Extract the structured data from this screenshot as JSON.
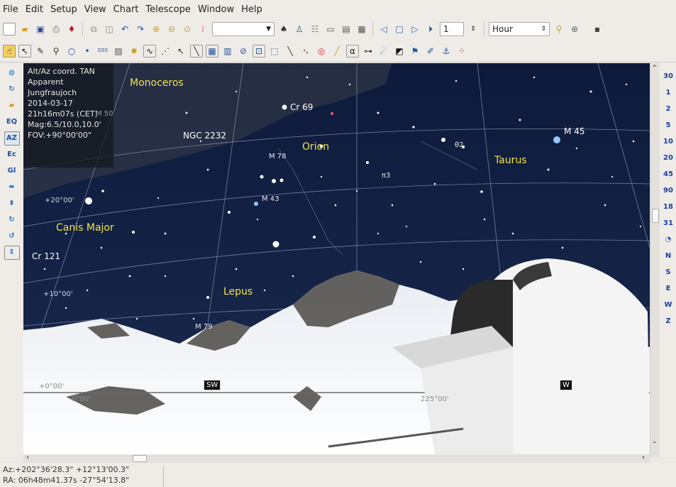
{
  "menu": [
    "File",
    "Edit",
    "Setup",
    "View",
    "Chart",
    "Telescope",
    "Window",
    "Help"
  ],
  "toolbar": {
    "search_value": "",
    "step_value": "1",
    "time_unit": "Hour"
  },
  "info": {
    "lines": [
      "Alt/Az coord. TAN",
      "Apparent",
      "Jungfraujoch",
      "2014-03-17",
      "21h16m07s (CET)",
      "Mag:6.5/10.0,10.0'",
      "FOV:+90°00'00\""
    ]
  },
  "sky": {
    "constellations": {
      "monoceros": "Monoceros",
      "orion": "Orion",
      "taurus": "Taurus",
      "canis_major": "Canis Major",
      "lepus": "Lepus"
    },
    "objects": {
      "cr69": "Cr 69",
      "ngc2232": "NGC 2232",
      "m45": "M 45",
      "m78": "M 78",
      "m43": "M 43",
      "cr121": "Cr 121",
      "m79": "M 79",
      "m50": "M 50",
      "theta2": "θ2",
      "pi3": "π3"
    },
    "grid": {
      "alt20": "+20°00'",
      "alt10": "+10°00'",
      "alt0a": "+0°00'",
      "alt0b": "0°00'",
      "az": "225°00'"
    },
    "directions": {
      "sw": "SW",
      "w": "W"
    }
  },
  "right_zoom": [
    "30",
    "1",
    "2",
    "5",
    "10",
    "20",
    "45",
    "90",
    "18",
    "31"
  ],
  "right_dirs": [
    "N",
    "S",
    "E",
    "W",
    "Z"
  ],
  "left_labels": [
    "EQ",
    "AZ",
    "Ec",
    "Gl"
  ],
  "status": {
    "line1": "Az:+202°36'28.3\" +12°13'00.3\"",
    "line2": "RA: 06h48m41.37s -27°54'13.8\""
  }
}
